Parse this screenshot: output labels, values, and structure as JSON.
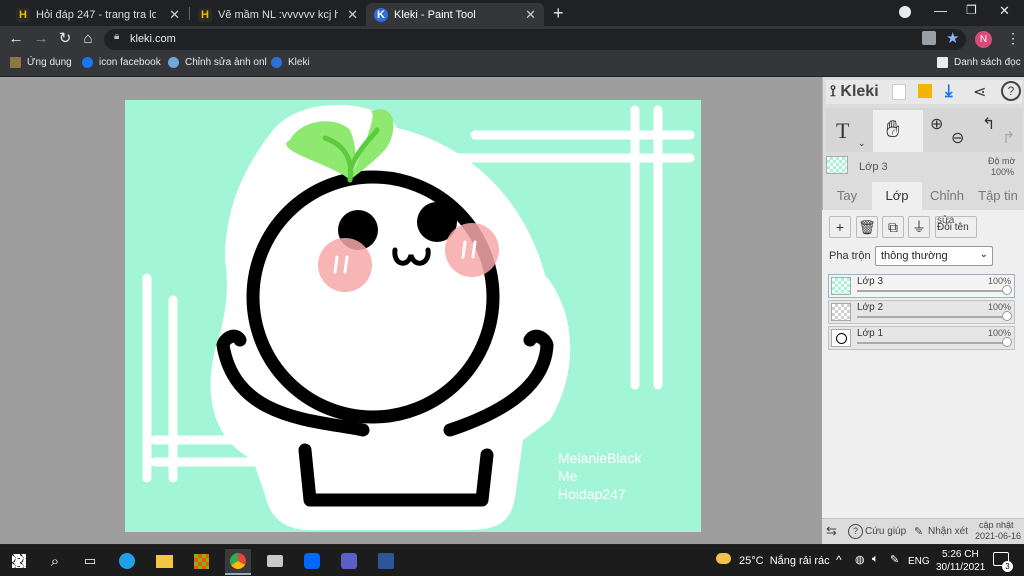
{
  "browser": {
    "tabs": [
      {
        "title": "Hỏi đáp 247 - trang tra loi",
        "favicon": "H",
        "active": false
      },
      {
        "title": "Vẽ mầm NL :vvvvvv kcj hết câu h",
        "favicon": "H",
        "active": false
      },
      {
        "title": "Kleki - Paint Tool",
        "favicon": "K",
        "active": true
      }
    ],
    "new_tab": "+",
    "url": "kleki.com",
    "profile_initial": "N",
    "bookmarks": [
      {
        "label": "Ứng dụng"
      },
      {
        "label": "icon facebook"
      },
      {
        "label": "Chỉnh sửa ảnh onl"
      },
      {
        "label": "Kleki"
      }
    ],
    "reading_list": "Danh sách đọc"
  },
  "canvas": {
    "signature_lines": [
      "MelanieBlack",
      "Me",
      "Hoidap247"
    ]
  },
  "panel": {
    "logo": "Kleki",
    "text_tool": "T",
    "layer_header": {
      "name": "Lớp 3",
      "opacity_label": "Độ mờ",
      "opacity_value": "100%"
    },
    "tabs": [
      "Tay",
      "Lớp",
      "Chỉnh",
      "Tập tin"
    ],
    "active_tab": "Lớp",
    "rename_top": "sửa",
    "rename_label": "Đổi tên",
    "blend_label": "Pha trộn",
    "blend_value": "thông thường",
    "layers": [
      {
        "name": "Lớp 3",
        "opacity": "100%",
        "selected": true
      },
      {
        "name": "Lớp 2",
        "opacity": "100%",
        "selected": false
      },
      {
        "name": "Lớp 1",
        "opacity": "100%",
        "selected": false
      }
    ],
    "footer": {
      "help": "Cứu giúp",
      "feedback": "Nhận xét",
      "update_label": "cập nhật",
      "update_date": "2021-06-16"
    }
  },
  "taskbar": {
    "weather": "25°C  Nắng rải rác",
    "lang": "ENG",
    "time": "5:26 CH",
    "date": "30/11/2021",
    "notif_count": "3"
  },
  "colors": {
    "canvas_bg": "#a2f5d6",
    "accent": "#1a73e8",
    "sprout": "#8fe870"
  }
}
